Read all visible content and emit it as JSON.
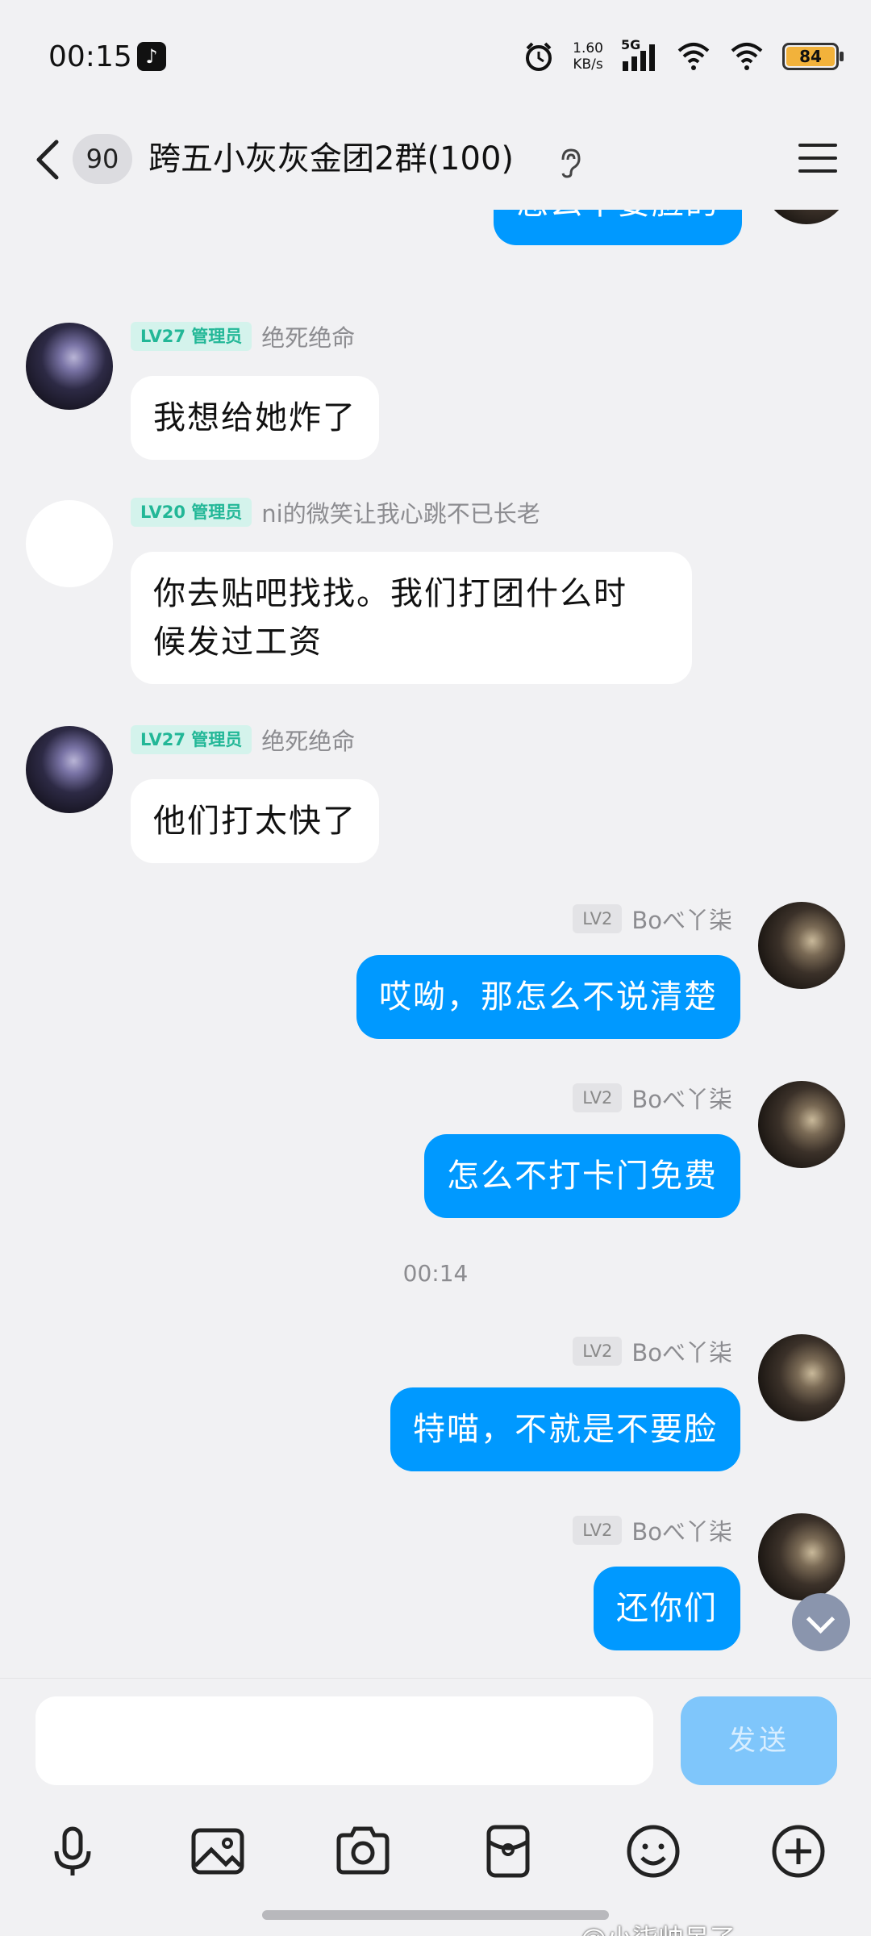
{
  "status_bar": {
    "time": "00:15",
    "net_speed_value": "1.60",
    "net_speed_unit": "KB/s",
    "network": "5G",
    "battery": "84",
    "battery_level": 0.84
  },
  "header": {
    "unread_count": "90",
    "title": "跨五小灰灰金团2群(100)"
  },
  "messages": {
    "m0": {
      "text": "怎么不要脸的"
    },
    "m1": {
      "level": "LV27",
      "role": "管理员",
      "nick": "绝死绝命",
      "text": "我想给她炸了"
    },
    "m2": {
      "level": "LV20",
      "role": "管理员",
      "nick": "ni的微笑让我心跳不已长老",
      "text_line1": "你去贴吧找找。我们打团什么时",
      "text_line2": "候发过工资"
    },
    "m3": {
      "level": "LV27",
      "role": "管理员",
      "nick": "绝死绝命",
      "text": "他们打太快了"
    },
    "m4": {
      "level": "LV2",
      "nick": "Boべ丫柒",
      "text": "哎呦，那怎么不说清楚"
    },
    "m5": {
      "level": "LV2",
      "nick": "Boべ丫柒",
      "text": "怎么不打卡门免费"
    },
    "time_sep": "00:14",
    "m6": {
      "level": "LV2",
      "nick": "Boべ丫柒",
      "text": "特喵，不就是不要脸"
    },
    "m7": {
      "level": "LV2",
      "nick": "Boべ丫柒",
      "text": "还你们"
    }
  },
  "input": {
    "value": "",
    "send_label": "发送"
  },
  "toolbar": [
    "mic-icon",
    "image-icon",
    "camera-icon",
    "red-packet-icon",
    "emoji-icon",
    "plus-icon"
  ],
  "watermark": "@小柒帅呆了",
  "colors": {
    "outgoing_bubble": "#0099ff",
    "incoming_bubble": "#ffffff",
    "admin_tag_bg": "#d4f3ec",
    "admin_tag_text": "#22b797",
    "send_button": "#7fc6fb"
  }
}
